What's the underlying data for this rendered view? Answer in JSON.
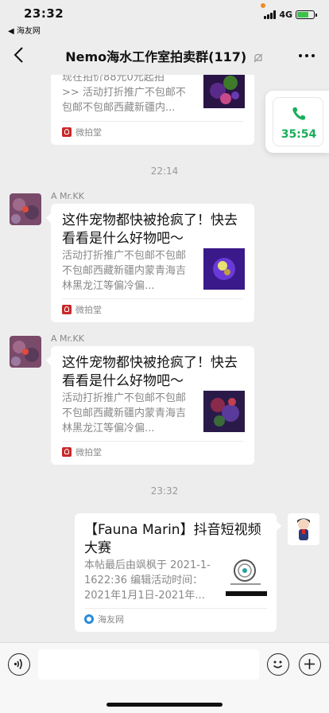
{
  "status_bar": {
    "time": "23:32",
    "back_app": "◀ 海友网",
    "network": "4G"
  },
  "nav": {
    "title": "Nemo海水工作室拍卖群(117)"
  },
  "call": {
    "duration": "35:54"
  },
  "messages": [
    {
      "type": "card",
      "desc": "现在拍价88元0元起拍\n>> 活动打折推广不包邮不包邮不包邮西藏新疆内...",
      "source": "微拍堂"
    },
    {
      "type": "timestamp",
      "text": "22:14"
    },
    {
      "type": "card",
      "sender": "A  Mr.KK",
      "title": "这件宠物都快被抢疯了！快去看看是什么好物吧～",
      "desc": "活动打折推广不包邮不包邮不包邮西藏新疆内蒙青海吉林黑龙江等偏冷偏...",
      "source": "微拍堂"
    },
    {
      "type": "card",
      "sender": "A  Mr.KK",
      "title": "这件宠物都快被抢疯了！快去看看是什么好物吧～",
      "desc": "活动打折推广不包邮不包邮不包邮西藏新疆内蒙青海吉林黑龙江等偏冷偏...",
      "source": "微拍堂"
    },
    {
      "type": "timestamp",
      "text": "23:32"
    },
    {
      "type": "card",
      "title": "【Fauna Marin】抖音短视频大赛",
      "desc": "本帖最后由飒枫于 2021-1-1622:36 编辑活动时间：2021年1月1日-2021年...",
      "source": "海友网"
    }
  ],
  "input": {
    "placeholder": ""
  },
  "colors": {
    "background": "#ededed",
    "call_green": "#1aad5a",
    "weipaitang_red": "#c8282b",
    "battery_green": "#3cc24b"
  }
}
